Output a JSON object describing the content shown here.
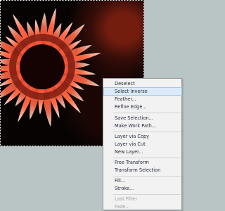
{
  "context_menu": {
    "items": [
      {
        "label": "Deselect",
        "enabled": true
      },
      {
        "label": "Select Inverse",
        "enabled": true,
        "highlighted": true
      },
      {
        "label": "Feather...",
        "enabled": true
      },
      {
        "label": "Refine Edge...",
        "enabled": true
      },
      {
        "label": "Save Selection...",
        "enabled": true
      },
      {
        "label": "Make Work Path...",
        "enabled": true
      },
      {
        "label": "Layer via Copy",
        "enabled": true
      },
      {
        "label": "Layer via Cut",
        "enabled": true
      },
      {
        "label": "New Layer...",
        "enabled": true
      },
      {
        "label": "Free Transform",
        "enabled": true
      },
      {
        "label": "Transform Selection",
        "enabled": true
      },
      {
        "label": "Fill...",
        "enabled": true
      },
      {
        "label": "Stroke...",
        "enabled": true
      },
      {
        "label": "Last Filter",
        "enabled": false
      },
      {
        "label": "Fade...",
        "enabled": false
      }
    ]
  },
  "colors": {
    "workspace_background": "#b9c4c4",
    "menu_background": "#f2f2f2",
    "menu_highlight": "#dbe9f8",
    "flower_petal": "#e0301e",
    "flower_tip": "#f7e6dc",
    "flower_center": "#140302",
    "canvas_dark": "#080303"
  },
  "icons": {
    "photo": "red-flower-image",
    "selection": "marching-ants-selection"
  }
}
